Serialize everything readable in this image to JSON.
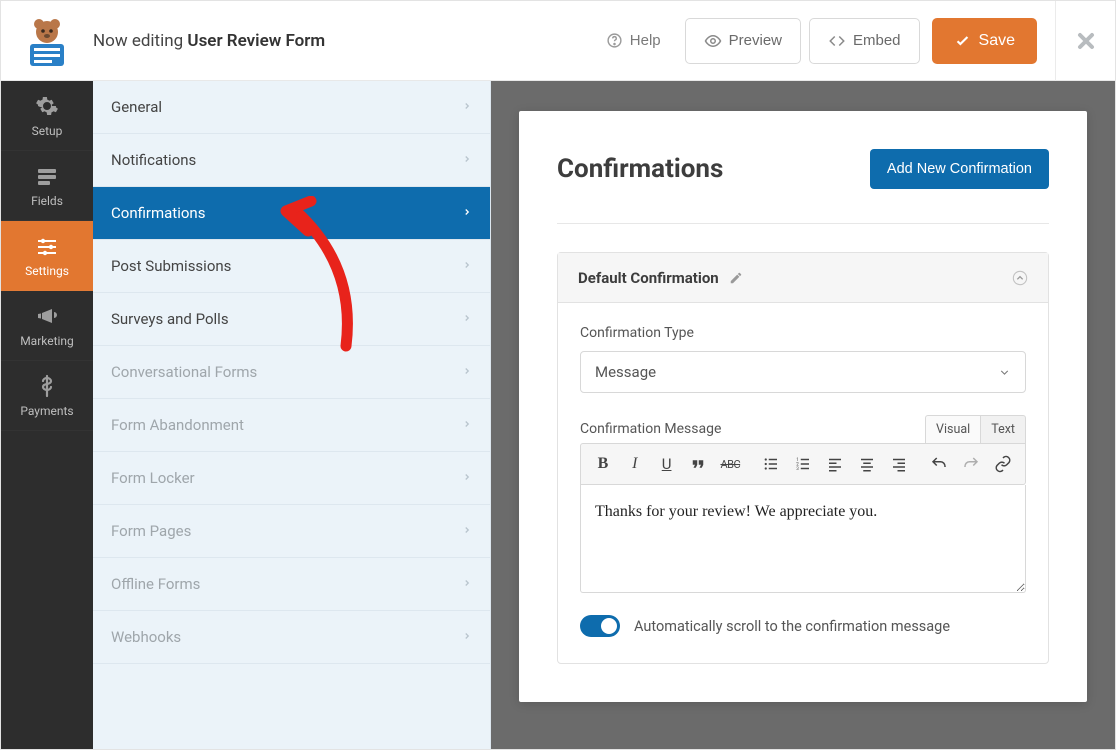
{
  "topbar": {
    "editing_prefix": "Now editing ",
    "form_name": "User Review Form",
    "help": "Help",
    "preview": "Preview",
    "embed": "Embed",
    "save": "Save"
  },
  "sidenav": {
    "items": [
      {
        "label": "Setup"
      },
      {
        "label": "Fields"
      },
      {
        "label": "Settings"
      },
      {
        "label": "Marketing"
      },
      {
        "label": "Payments"
      }
    ]
  },
  "secnav": {
    "items": [
      {
        "label": "General",
        "disabled": false,
        "active": false
      },
      {
        "label": "Notifications",
        "disabled": false,
        "active": false
      },
      {
        "label": "Confirmations",
        "disabled": false,
        "active": true
      },
      {
        "label": "Post Submissions",
        "disabled": false,
        "active": false
      },
      {
        "label": "Surveys and Polls",
        "disabled": false,
        "active": false
      },
      {
        "label": "Conversational Forms",
        "disabled": true,
        "active": false
      },
      {
        "label": "Form Abandonment",
        "disabled": true,
        "active": false
      },
      {
        "label": "Form Locker",
        "disabled": true,
        "active": false
      },
      {
        "label": "Form Pages",
        "disabled": true,
        "active": false
      },
      {
        "label": "Offline Forms",
        "disabled": true,
        "active": false
      },
      {
        "label": "Webhooks",
        "disabled": true,
        "active": false
      }
    ]
  },
  "content": {
    "title": "Confirmations",
    "add_button": "Add New Confirmation",
    "panel": {
      "title": "Default Confirmation",
      "type_label": "Confirmation Type",
      "type_value": "Message",
      "message_label": "Confirmation Message",
      "tabs": {
        "visual": "Visual",
        "text": "Text"
      },
      "message_value": "Thanks for your review! We appreciate you.",
      "toggle_label": "Automatically scroll to the confirmation message"
    }
  }
}
